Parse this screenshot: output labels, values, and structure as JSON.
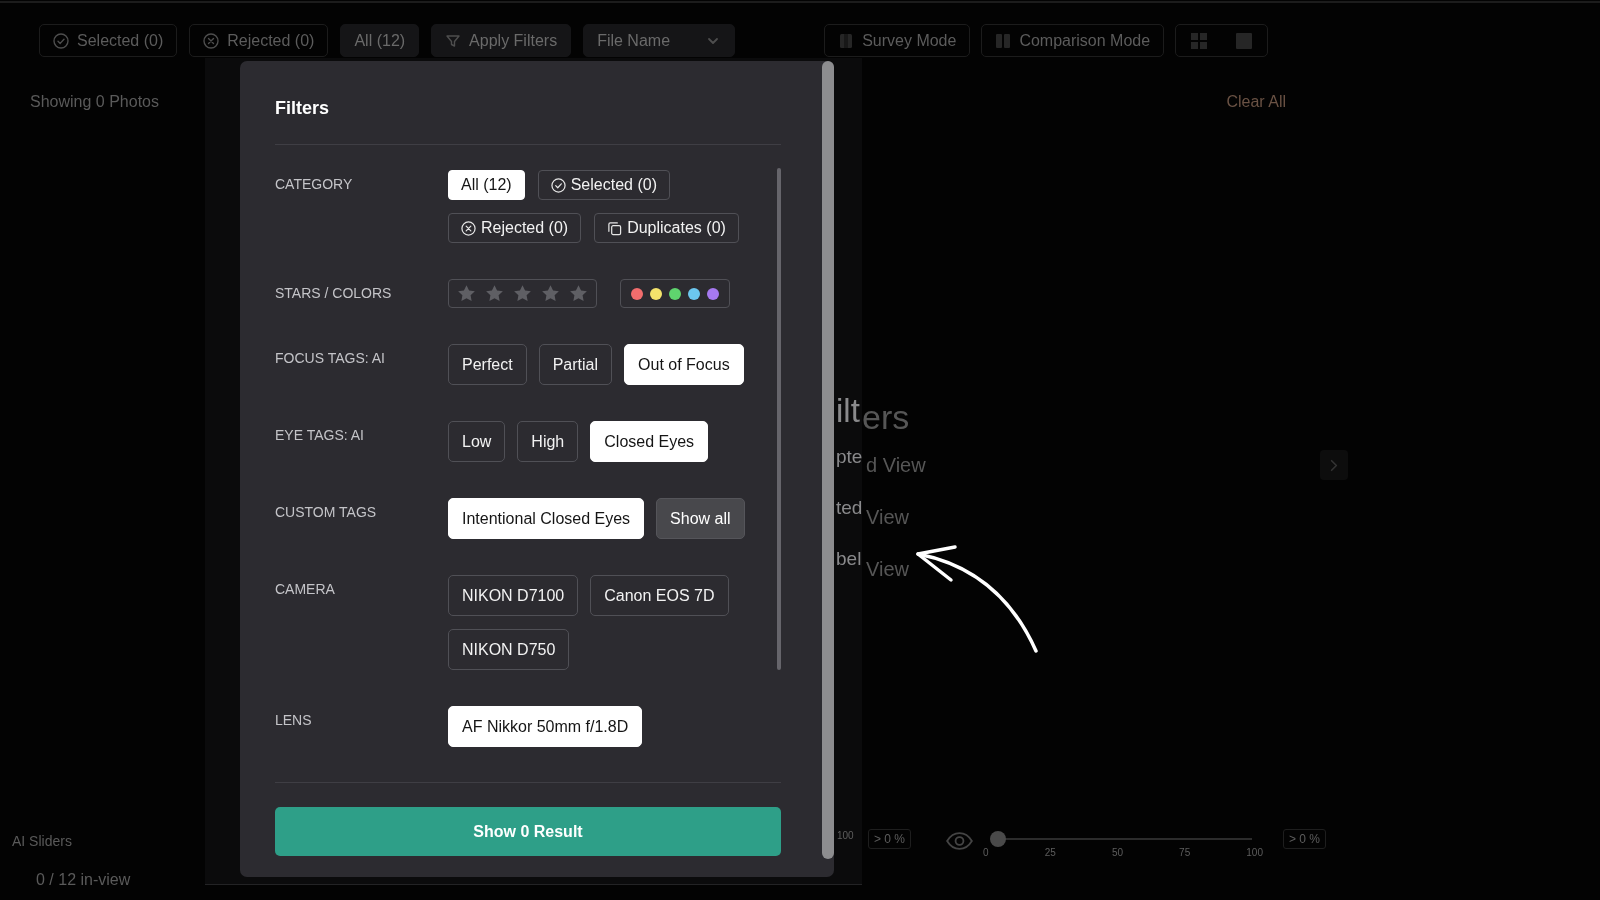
{
  "toolbar": {
    "category_tabs": [
      {
        "label": "Selected (0)",
        "kind": "accepted",
        "selected": false
      },
      {
        "label": "Rejected (0)",
        "kind": "rejected",
        "selected": false
      },
      {
        "label": "All (12)",
        "kind": "plain",
        "selected": true
      }
    ],
    "apply_button": "Apply Filters",
    "sort_select": {
      "value": "File Name"
    },
    "mode_buttons": [
      {
        "label": "Survey Mode",
        "kind": "survey"
      },
      {
        "label": "Comparison Mode",
        "kind": "comparison"
      }
    ]
  },
  "results_bar": {
    "count": "Showing 0 Photos",
    "clear_button": "Clear All"
  },
  "background_panel": {
    "title": "ers",
    "items": [
      "d View",
      "View",
      "View"
    ]
  },
  "overlay_panel": {
    "title": "ilt",
    "items": [
      "pte",
      "ted",
      "bel"
    ]
  },
  "filters_modal": {
    "title": "Filters",
    "sections": [
      {
        "label": "CATEGORY",
        "kind": "category",
        "options": [
          {
            "label": "All (12)",
            "kind": "plain",
            "selected": true
          },
          {
            "label": "Selected (0)",
            "kind": "accepted",
            "selected": false
          },
          {
            "label": "Rejected (0)",
            "kind": "rejected",
            "selected": false
          },
          {
            "label": "Duplicates (0)",
            "kind": "duplicates",
            "selected": false
          }
        ]
      },
      {
        "label": "STARS / COLORS",
        "kind": "rating",
        "stars": 0,
        "colors": [
          {
            "color": "#f26d6d"
          },
          {
            "color": "#f4e36b"
          },
          {
            "color": "#5fd46e"
          },
          {
            "color": "#6cc7ef"
          },
          {
            "color": "#a679f0"
          }
        ]
      },
      {
        "label": "FOCUS TAGS: AI",
        "kind": "tags",
        "options": [
          {
            "label": "Perfect",
            "selected": false
          },
          {
            "label": "Partial",
            "selected": false
          },
          {
            "label": "Out of Focus",
            "selected": true
          }
        ]
      },
      {
        "label": "EYE TAGS: AI",
        "kind": "tags",
        "options": [
          {
            "label": "Low",
            "selected": false
          },
          {
            "label": "High",
            "selected": false
          },
          {
            "label": "Closed Eyes",
            "selected": true
          }
        ]
      },
      {
        "label": "CUSTOM TAGS",
        "kind": "tags",
        "options": [
          {
            "label": "Intentional Closed Eyes",
            "selected": true
          }
        ],
        "show_all": "Show all"
      },
      {
        "label": "CAMERA",
        "kind": "tags",
        "options": [
          {
            "label": "NIKON D7100",
            "selected": false
          },
          {
            "label": "Canon EOS 7D",
            "selected": false
          },
          {
            "label": "NIKON D750",
            "selected": false
          }
        ]
      },
      {
        "label": "LENS",
        "kind": "tags",
        "options": [
          {
            "label": "AF Nikkor 50mm f/1.8D",
            "selected": true
          }
        ]
      }
    ],
    "submit": "Show 0 Result"
  },
  "ai_sliders": {
    "title": "AI Sliders",
    "sliders": [
      {
        "ticks": [
          "100"
        ],
        "reading": "> 0 %"
      },
      {
        "ticks": [
          "0",
          "25",
          "50",
          "75",
          "100"
        ],
        "level": 0,
        "reading": "> 0 %"
      }
    ]
  },
  "in_view": "0 / 12 in-view"
}
